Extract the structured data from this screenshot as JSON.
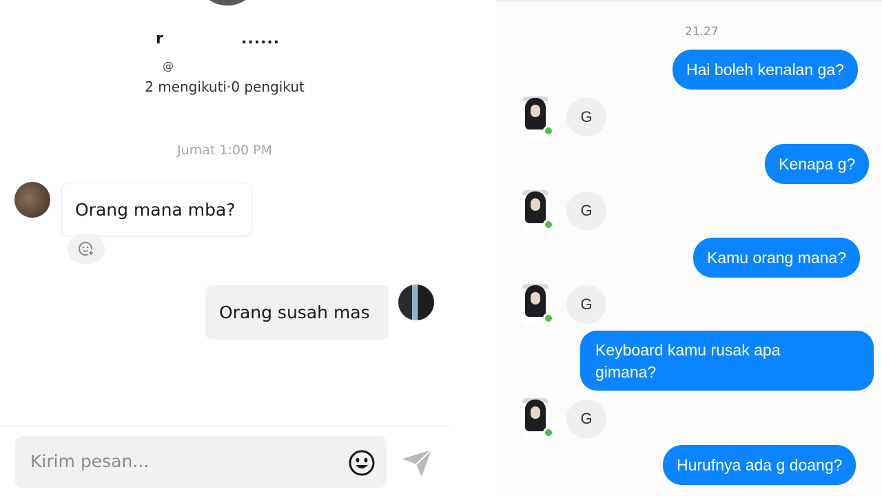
{
  "left_chat": {
    "profile": {
      "name_visible": "r",
      "name_trailing": "......",
      "handle_prefix": "@",
      "following_label": "2 mengikuti",
      "separator": " · ",
      "followers_label": "0 pengikut"
    },
    "timestamp": "Jumat 1:00 PM",
    "messages": [
      {
        "direction": "in",
        "text": "Orang mana mba?"
      },
      {
        "direction": "out",
        "text": "Orang susah mas"
      }
    ],
    "composer": {
      "placeholder": "Kirim pesan...",
      "emoji_icon": "smiley-icon",
      "send_icon": "send-arrow-icon"
    },
    "reaction_icon": "add-reaction-icon"
  },
  "right_chat": {
    "timestamp": "21.27",
    "messages": [
      {
        "direction": "out",
        "text": "Hai boleh kenalan ga?"
      },
      {
        "direction": "in",
        "text": "G"
      },
      {
        "direction": "out",
        "text": "Kenapa g?"
      },
      {
        "direction": "in",
        "text": "G"
      },
      {
        "direction": "out",
        "text": "Kamu orang mana?"
      },
      {
        "direction": "in",
        "text": "G"
      },
      {
        "direction": "out",
        "text": "Keyboard kamu rusak apa gimana?"
      },
      {
        "direction": "in",
        "text": "G"
      },
      {
        "direction": "out",
        "text": "Hurufnya ada g doang?"
      }
    ],
    "colors": {
      "outgoing_bubble": "#0b84ff",
      "incoming_bubble": "#efefef",
      "online_dot": "#4fbf4a"
    }
  }
}
